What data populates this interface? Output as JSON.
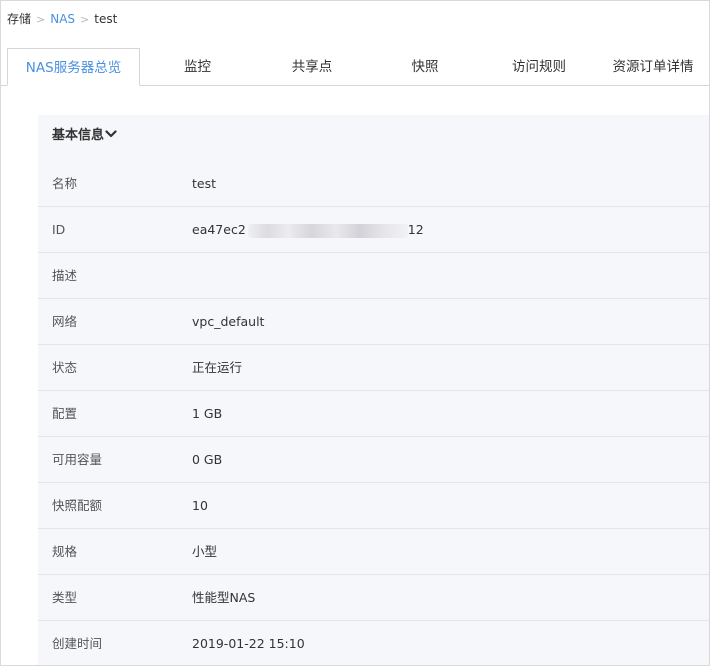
{
  "breadcrumb": {
    "root": "存储",
    "separator": ">",
    "section": "NAS",
    "current": "test"
  },
  "tabs": [
    {
      "label": "NAS服务器总览",
      "active": true
    },
    {
      "label": "监控",
      "active": false
    },
    {
      "label": "共享点",
      "active": false
    },
    {
      "label": "快照",
      "active": false
    },
    {
      "label": "访问规则",
      "active": false
    },
    {
      "label": "资源订单详情",
      "active": false
    }
  ],
  "basic_info": {
    "title": "基本信息",
    "rows": [
      {
        "label": "名称",
        "value": "test"
      },
      {
        "label": "ID",
        "value_prefix": "ea47ec2",
        "value_suffix": "12"
      },
      {
        "label": "描述",
        "value": ""
      },
      {
        "label": "网络",
        "value": "vpc_default"
      },
      {
        "label": "状态",
        "value": "正在运行"
      },
      {
        "label": "配置",
        "value": "1 GB"
      },
      {
        "label": "可用容量",
        "value": "0 GB"
      },
      {
        "label": "快照配额",
        "value": "10"
      },
      {
        "label": "规格",
        "value": "小型"
      },
      {
        "label": "类型",
        "value": "性能型NAS"
      },
      {
        "label": "创建时间",
        "value": "2019-01-22 15:10"
      }
    ]
  },
  "colors": {
    "accent": "#4a90e2",
    "panel_bg": "#f6f7fb",
    "divider": "#e3e5eb"
  },
  "icons": {
    "collapse": "chevron-down-icon"
  }
}
